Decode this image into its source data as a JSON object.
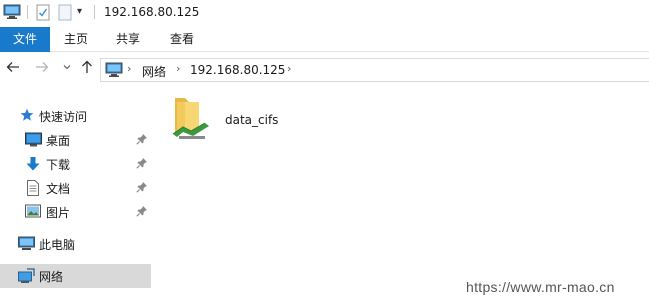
{
  "title_bar": {
    "title": "192.168.80.125",
    "icons": [
      "computer-icon",
      "properties-icon",
      "new-folder-icon",
      "customize-dropdown-icon"
    ]
  },
  "ribbon": {
    "tabs": [
      {
        "label": "文件",
        "active": true
      },
      {
        "label": "主页"
      },
      {
        "label": "共享"
      },
      {
        "label": "查看"
      }
    ]
  },
  "address_bar": {
    "crumbs": [
      "网络",
      "192.168.80.125"
    ]
  },
  "sidebar": {
    "quick_access": "快速访问",
    "items": [
      {
        "label": "桌面",
        "icon": "desktop-icon",
        "pinned": true
      },
      {
        "label": "下载",
        "icon": "download-icon",
        "pinned": true
      },
      {
        "label": "文档",
        "icon": "document-icon",
        "pinned": true
      },
      {
        "label": "图片",
        "icon": "pictures-icon",
        "pinned": true
      }
    ],
    "this_pc": "此电脑",
    "network": "网络"
  },
  "content": {
    "items": [
      {
        "name": "data_cifs",
        "icon": "network-share-folder-icon"
      }
    ]
  },
  "watermark": "https://www.mr-mao.cn",
  "colors": {
    "file_tab": "#1979ca",
    "selection_grey": "#d9d9d9",
    "accent_blue": "#1979ca"
  }
}
